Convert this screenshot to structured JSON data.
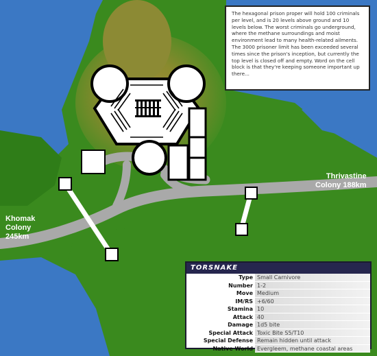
{
  "places": {
    "khomak": {
      "name": "Khomak",
      "line2": "Colony",
      "distance": "245km"
    },
    "thrivastine": {
      "name": "Thrivastine",
      "line2": "Colony 188km"
    }
  },
  "note": {
    "text": "The hexagonal prison proper will hold 100 criminals per level, and is 20 levels above ground and 10 levels below.  The worst criminals go underground, where the methane surroundings and moist environment lead to many health-related ailments.  The 3000 prisoner limit has been exceeded several times since the prison's inception, but currently the top level is closed off and empty.  Word on the cell block is that they're keeping someone important up there..."
  },
  "creature": {
    "name": "TORSNAKE",
    "stats": [
      {
        "label": "Type",
        "value": "Small Carnivore"
      },
      {
        "label": "Number",
        "value": "1-2"
      },
      {
        "label": "Move",
        "value": "Medium"
      },
      {
        "label": "IM/RS",
        "value": "+6/60"
      },
      {
        "label": "Stamina",
        "value": "10"
      },
      {
        "label": "Attack",
        "value": "40"
      },
      {
        "label": "Damage",
        "value": "1d5 bite"
      },
      {
        "label": "Special Attack",
        "value": "Toxic Bite S5/T10"
      },
      {
        "label": "Special Defense",
        "value": "Remain hidden until attack"
      },
      {
        "label": "Native World",
        "value": "Evergleem, methane coastal areas"
      }
    ]
  },
  "colors": {
    "water": "#3b78c4",
    "land": "#3a8a1e",
    "highland": "#8a7a30",
    "road": "#a9a9a9",
    "statHeader": "#26264e"
  }
}
